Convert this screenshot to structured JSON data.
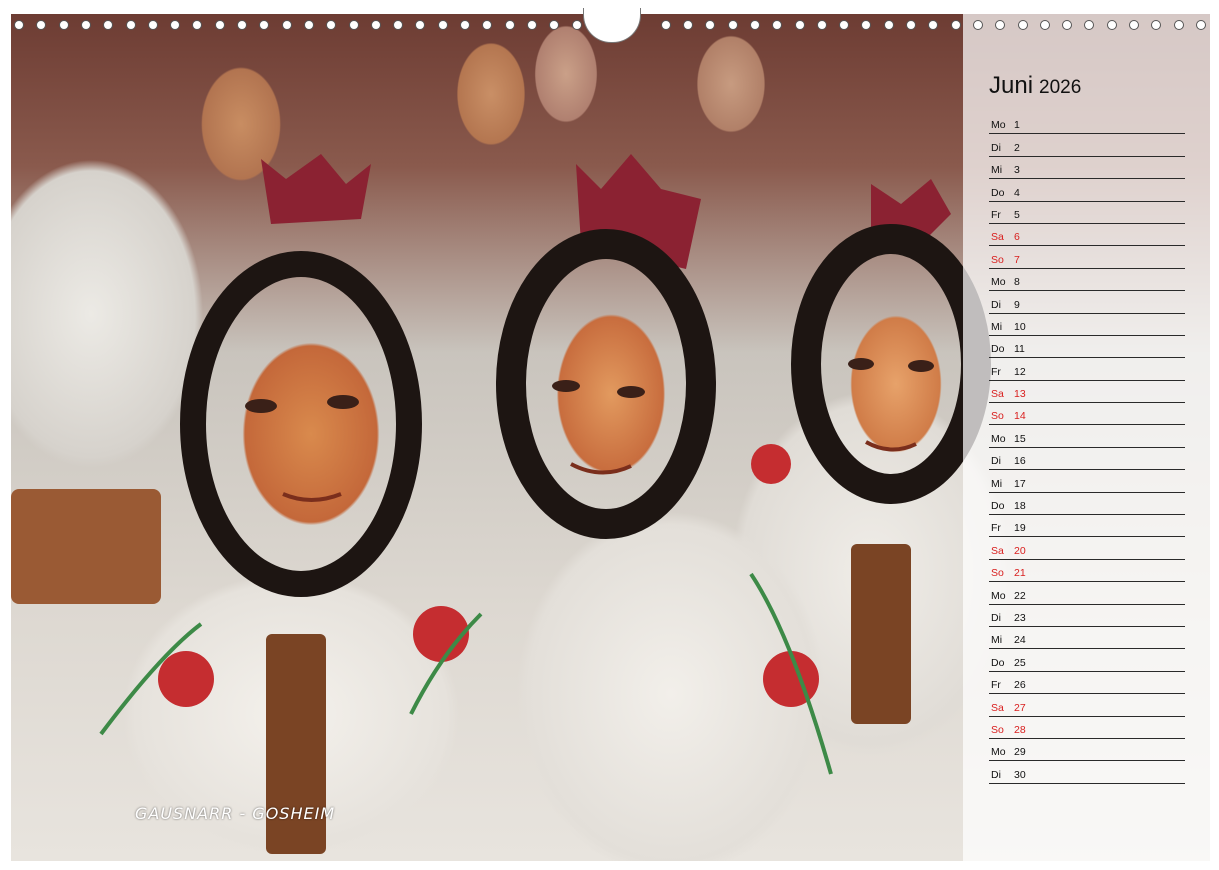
{
  "photo": {
    "caption": "GAUSNARR - GOSHEIM"
  },
  "calendar": {
    "month": "Juni",
    "year": "2026",
    "days": [
      {
        "wd": "Mo",
        "d": "1",
        "weekend": false
      },
      {
        "wd": "Di",
        "d": "2",
        "weekend": false
      },
      {
        "wd": "Mi",
        "d": "3",
        "weekend": false
      },
      {
        "wd": "Do",
        "d": "4",
        "weekend": false
      },
      {
        "wd": "Fr",
        "d": "5",
        "weekend": false
      },
      {
        "wd": "Sa",
        "d": "6",
        "weekend": true
      },
      {
        "wd": "So",
        "d": "7",
        "weekend": true
      },
      {
        "wd": "Mo",
        "d": "8",
        "weekend": false
      },
      {
        "wd": "Di",
        "d": "9",
        "weekend": false
      },
      {
        "wd": "Mi",
        "d": "10",
        "weekend": false
      },
      {
        "wd": "Do",
        "d": "11",
        "weekend": false
      },
      {
        "wd": "Fr",
        "d": "12",
        "weekend": false
      },
      {
        "wd": "Sa",
        "d": "13",
        "weekend": true
      },
      {
        "wd": "So",
        "d": "14",
        "weekend": true
      },
      {
        "wd": "Mo",
        "d": "15",
        "weekend": false
      },
      {
        "wd": "Di",
        "d": "16",
        "weekend": false
      },
      {
        "wd": "Mi",
        "d": "17",
        "weekend": false
      },
      {
        "wd": "Do",
        "d": "18",
        "weekend": false
      },
      {
        "wd": "Fr",
        "d": "19",
        "weekend": false
      },
      {
        "wd": "Sa",
        "d": "20",
        "weekend": true
      },
      {
        "wd": "So",
        "d": "21",
        "weekend": true
      },
      {
        "wd": "Mo",
        "d": "22",
        "weekend": false
      },
      {
        "wd": "Di",
        "d": "23",
        "weekend": false
      },
      {
        "wd": "Mi",
        "d": "24",
        "weekend": false
      },
      {
        "wd": "Do",
        "d": "25",
        "weekend": false
      },
      {
        "wd": "Fr",
        "d": "26",
        "weekend": false
      },
      {
        "wd": "Sa",
        "d": "27",
        "weekend": true
      },
      {
        "wd": "So",
        "d": "28",
        "weekend": true
      },
      {
        "wd": "Mo",
        "d": "29",
        "weekend": false
      },
      {
        "wd": "Di",
        "d": "30",
        "weekend": false
      }
    ]
  },
  "colors": {
    "weekend": "#d9201f",
    "text": "#111111"
  }
}
